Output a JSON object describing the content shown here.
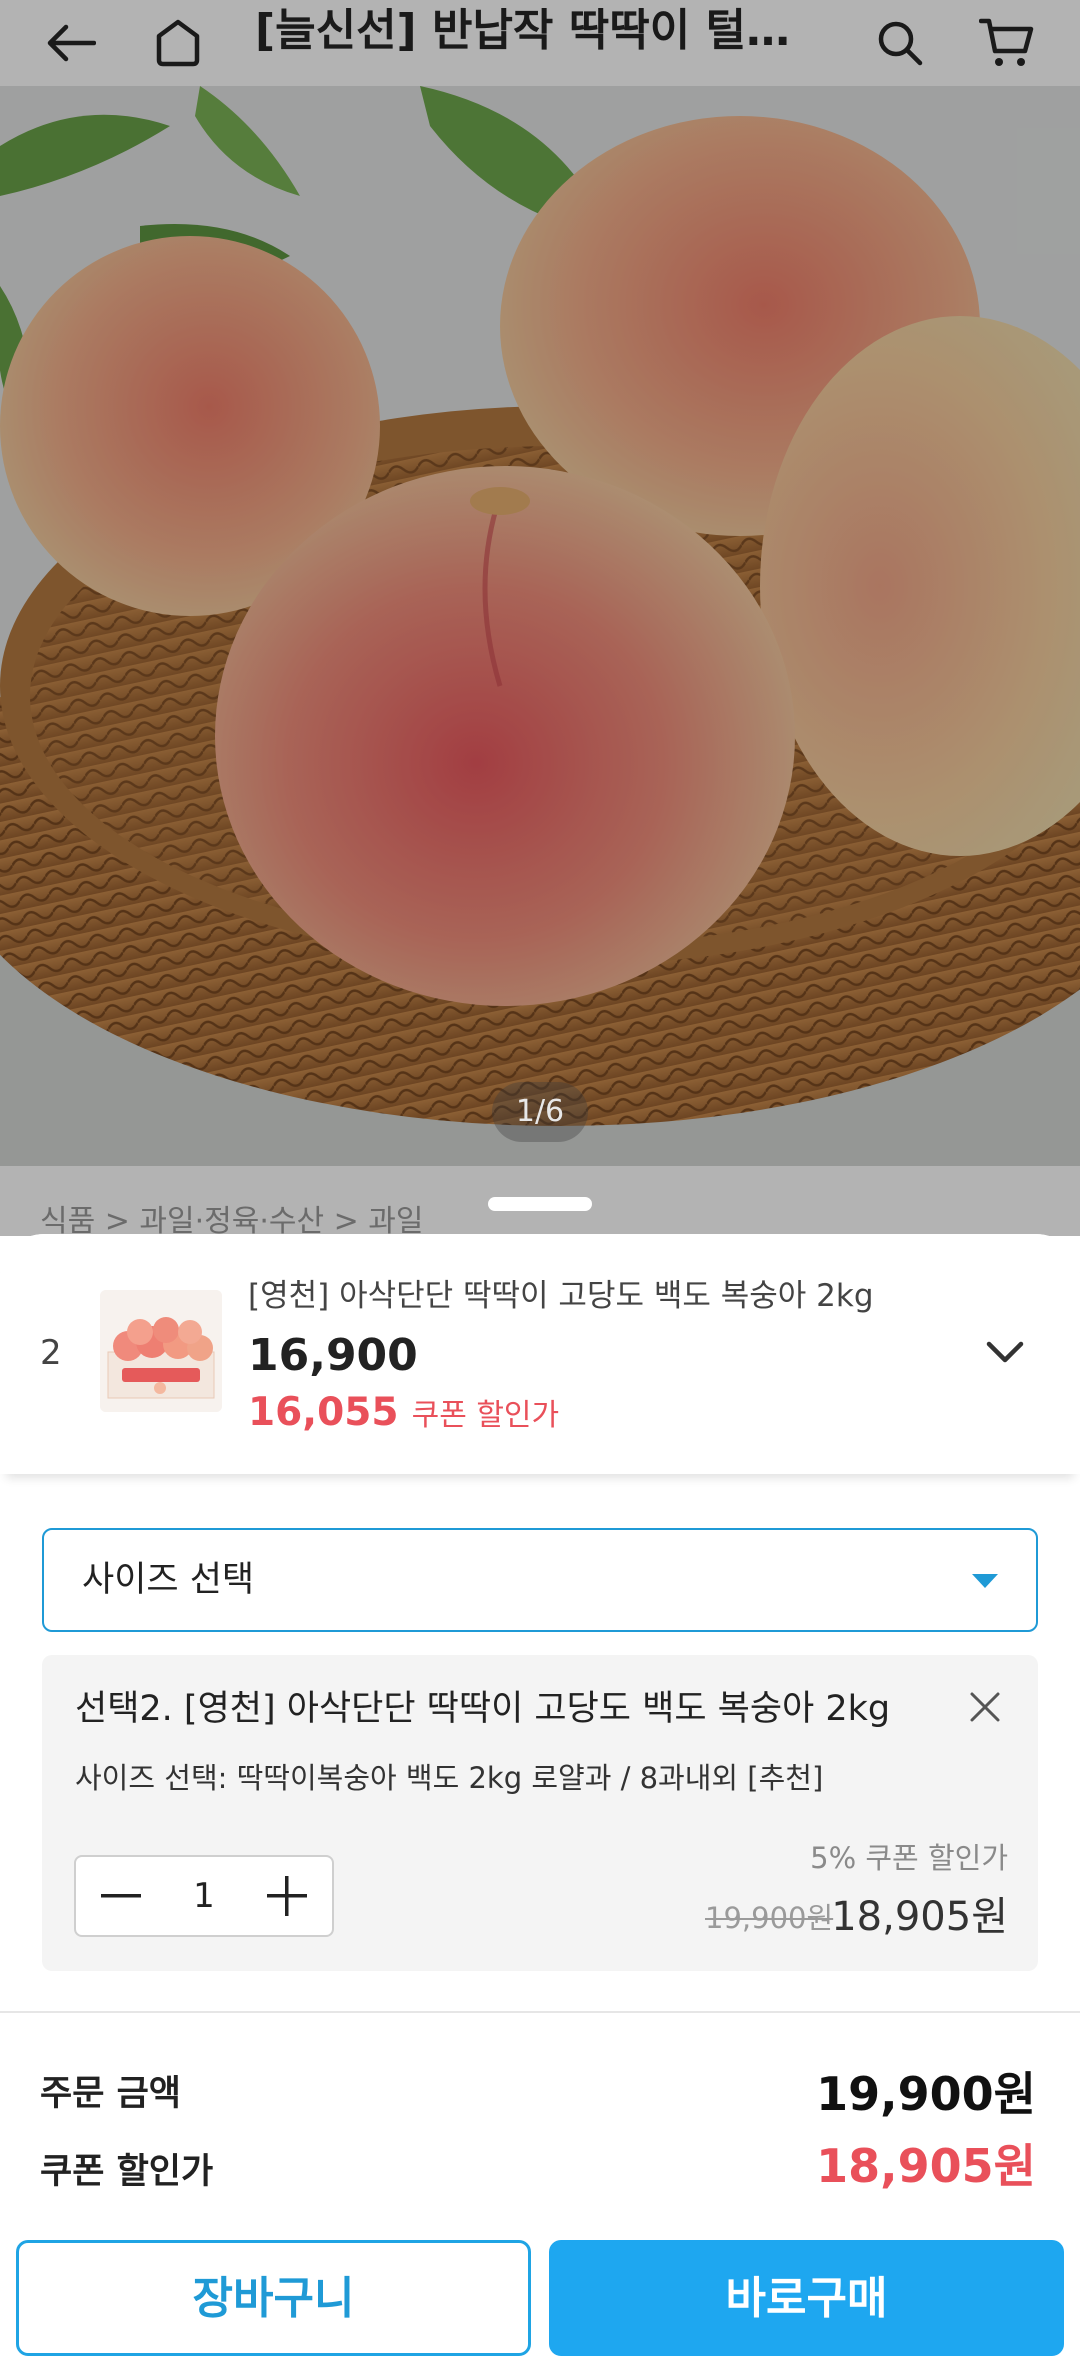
{
  "header": {
    "title": "[늘신선] 반납작 딱딱이 털복숭아 백도",
    "back_icon": "arrow-left-icon",
    "home_icon": "home-icon",
    "search_icon": "search-icon",
    "cart_icon": "cart-icon"
  },
  "gallery": {
    "counter": "1/6"
  },
  "breadcrumb": "식품 > 과일·정육·수산 > 과일",
  "selected_option": {
    "number": "2",
    "title": "[영천] 아삭단단 딱딱이 고당도 백도 복숭아 2kg",
    "price": "16,900",
    "coupon_price": "16,055",
    "coupon_label": "쿠폰 할인가"
  },
  "size_select": {
    "label": "사이즈 선택"
  },
  "selection": {
    "title": "선택2. [영천] 아삭단단 딱딱이 고당도 백도 복숭아 2kg",
    "option": "사이즈 선택: 딱딱이복숭아 백도 2kg 로얄과 / 8과내외 [추천]",
    "quantity": "1",
    "coupon_label": "5% 쿠폰 할인가",
    "original_price": "19,900원",
    "discounted_price": "18,905원"
  },
  "summary": {
    "order_label": "주문 금액",
    "order_value": "19,900원",
    "coupon_label": "쿠폰 할인가",
    "coupon_value": "18,905원"
  },
  "buttons": {
    "cart": "장바구니",
    "buy": "바로구매"
  },
  "colors": {
    "accent": "#1ea7f0",
    "coupon_red": "#e9505a",
    "select_border": "#1f9ad6"
  }
}
